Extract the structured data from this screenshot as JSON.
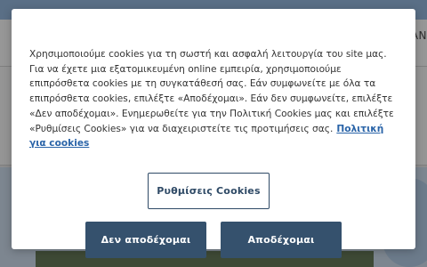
{
  "background": {
    "header_partial_text": "AN"
  },
  "consent": {
    "message": "Χρησιμοποιούμε cookies για τη σωστή και ασφαλή λειτουργία του site μας. Για να έχετε μια εξατομικευμένη online εμπειρία, χρησιμοποιούμε επιπρόσθετα cookies με τη συγκατάθεσή σας. Εάν συμφωνείτε με όλα τα επιπρόσθετα cookies, επιλέξτε «Αποδέχομαι». Εάν δεν συμφωνείτε, επιλέξτε «Δεν αποδέχομαι». Ενημερωθείτε για την Πολιτική Cookies μας και επιλέξτε «Ρυθμίσεις Cookies» για να διαχειριστείτε τις προτιμήσεις σας.",
    "policy_link": "Πολιτική για cookies",
    "settings_button": "Ρυθμίσεις Cookies",
    "reject_button": "Δεν αποδέχομαι",
    "accept_button": "Αποδέχομαι"
  },
  "colors": {
    "primary_button": "#35516d",
    "link": "#2a64a8",
    "overlay": "#8c8c8c"
  }
}
